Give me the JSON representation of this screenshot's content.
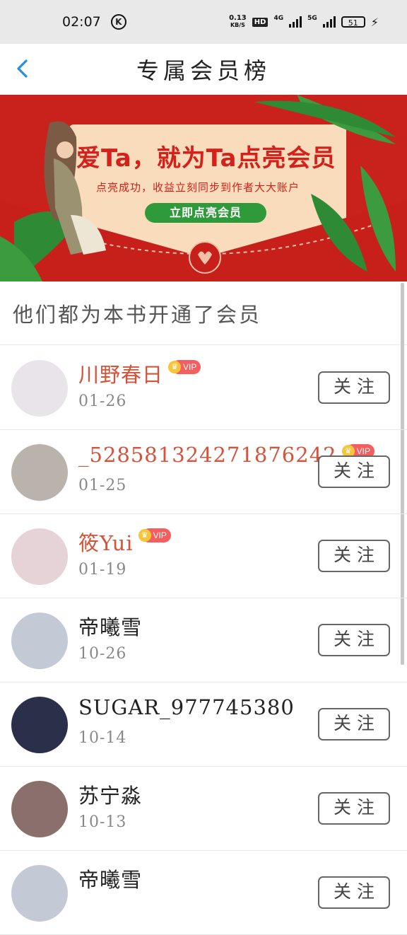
{
  "status_bar": {
    "time": "02:07",
    "net_speed": "0.13",
    "net_unit": "KB/S",
    "hd_label": "HD",
    "net4g": "4G",
    "net5g": "5G",
    "battery": "51"
  },
  "header": {
    "title": "专属会员榜"
  },
  "banner": {
    "headline": "爱Ta，就为Ta点亮会员",
    "subline": "点亮成功，收益立刻同步到作者大大账户",
    "button_label": "立即点亮会员"
  },
  "section": {
    "title": "他们都为本书开通了会员"
  },
  "vip_label": "VIP",
  "follow_label": "关注",
  "members": [
    {
      "name": "川野春日",
      "date": "01-26",
      "vip": true,
      "avatar_color": "#e9e4ea"
    },
    {
      "name": "_528581324271876242",
      "date": "01-25",
      "vip": true,
      "avatar_color": "#b9b3ab"
    },
    {
      "name": "筱Yui",
      "date": "01-19",
      "vip": true,
      "avatar_color": "#e6d3d8"
    },
    {
      "name": "帝曦雪",
      "date": "10-26",
      "vip": false,
      "avatar_color": "#c4c9d6"
    },
    {
      "name": "SUGAR_977745380",
      "date": "10-14",
      "vip": false,
      "avatar_color": "#2a2f4a"
    },
    {
      "name": "苏宁淼",
      "date": "10-13",
      "vip": false,
      "avatar_color": "#8a6f6c"
    },
    {
      "name": "帝曦雪",
      "date": "",
      "vip": false,
      "avatar_color": "#c4c9d6"
    }
  ]
}
